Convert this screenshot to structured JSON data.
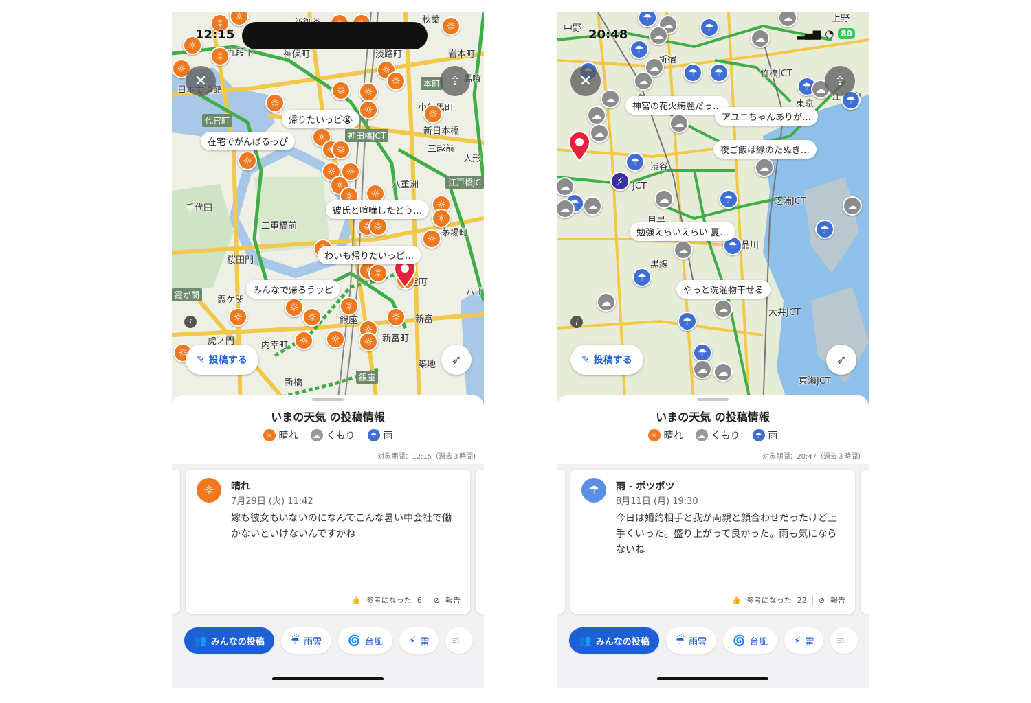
{
  "left": {
    "status_time": "12:15",
    "places": [
      {
        "text": "新御茶",
        "cls": "place"
      },
      {
        "text": "秋葉",
        "cls": "place"
      },
      {
        "text": "九段下",
        "cls": "place"
      },
      {
        "text": "神保町",
        "cls": "place"
      },
      {
        "text": "淡路町",
        "cls": "place"
      },
      {
        "text": "岩本町",
        "cls": "place"
      },
      {
        "text": "日本武道館",
        "cls": "place"
      },
      {
        "text": "本町",
        "cls": "road-label"
      },
      {
        "text": "馬喰",
        "cls": "place"
      },
      {
        "text": "小伝馬町",
        "cls": "place"
      },
      {
        "text": "代官町",
        "cls": "road-label"
      },
      {
        "text": "神田橋JCT",
        "cls": "road-label"
      },
      {
        "text": "新日本橋",
        "cls": "place"
      },
      {
        "text": "三越前",
        "cls": "place"
      },
      {
        "text": "人形",
        "cls": "place"
      },
      {
        "text": "千代田",
        "cls": "place"
      },
      {
        "text": "八重洲",
        "cls": "place"
      },
      {
        "text": "江戸橋JC",
        "cls": "road-label"
      },
      {
        "text": "二重橋前",
        "cls": "place"
      },
      {
        "text": "茅場町",
        "cls": "place"
      },
      {
        "text": "桜田門",
        "cls": "place"
      },
      {
        "text": "宝町",
        "cls": "place"
      },
      {
        "text": "八丁",
        "cls": "place"
      },
      {
        "text": "霞が関",
        "cls": "road-label"
      },
      {
        "text": "霞ケ関",
        "cls": "place"
      },
      {
        "text": "銀座",
        "cls": "place"
      },
      {
        "text": "新富",
        "cls": "place"
      },
      {
        "text": "虎ノ門",
        "cls": "place"
      },
      {
        "text": "内幸町",
        "cls": "place"
      },
      {
        "text": "新富町",
        "cls": "place"
      },
      {
        "text": "築地",
        "cls": "place"
      },
      {
        "text": "新橋",
        "cls": "place"
      },
      {
        "text": "銀座",
        "cls": "road-label"
      }
    ],
    "bubbles": [
      "帰りたいっピ😭",
      "在宅でがんばるっぴ",
      "彼氏と喧嘩したどう…",
      "わいも帰りたいっピ…",
      "みんなで帰ろうッピ"
    ],
    "card": {
      "weather": "晴れ",
      "date": "7月29日 (火) 11:42",
      "body": "嫁も彼女もいないのになんでこんな暑い中会社で働かないといけないんですかね",
      "helpful_label": "参考になった",
      "helpful_count": "6",
      "report_label": "報告"
    },
    "period": "対象期間：12:15（過去３時間)"
  },
  "right": {
    "status_time": "20:48",
    "battery": "80",
    "places": [
      {
        "text": "中野",
        "cls": "place"
      },
      {
        "text": "上野",
        "cls": "place"
      },
      {
        "text": "新宿",
        "cls": "place"
      },
      {
        "text": "竹橋JCT",
        "cls": "place"
      },
      {
        "text": "東京",
        "cls": "place"
      },
      {
        "text": "江戸橋J",
        "cls": "place"
      },
      {
        "text": "渋谷",
        "cls": "place"
      },
      {
        "text": "JCT",
        "cls": "place"
      },
      {
        "text": "芝浦JCT",
        "cls": "place"
      },
      {
        "text": "目黒",
        "cls": "place"
      },
      {
        "text": "品川",
        "cls": "place"
      },
      {
        "text": "黒線",
        "cls": "place"
      },
      {
        "text": "大井JCT",
        "cls": "place"
      },
      {
        "text": "東海JCT",
        "cls": "place"
      }
    ],
    "bubbles": [
      "神宮の花火綺麗だっ…",
      "アユニちゃんありが…",
      "夜ご飯は緑のたぬき…",
      "勉強えらいえらい 夏…",
      "やっと洗濯物干せる"
    ],
    "card": {
      "weather": "雨 - ポツポツ",
      "date": "8月11日 (月) 19:30",
      "body": "今日は婚約相手と我が両親と顔合わせだったけど上手くいった。盛り上がって良かった。雨も気にならないね",
      "helpful_label": "参考になった",
      "helpful_count": "22",
      "report_label": "報告"
    },
    "period": "対象期間：20:47（過去３時間)"
  },
  "common": {
    "post_button": "投稿する",
    "sheet_title": "いまの天気 の投稿情報",
    "legend": [
      {
        "label": "晴れ",
        "kind": "sunny"
      },
      {
        "label": "くもり",
        "kind": "cloudy"
      },
      {
        "label": "雨",
        "kind": "rain"
      }
    ],
    "chips": [
      {
        "label": "みんなの投稿",
        "icon": "people-icon"
      },
      {
        "label": "雨雲",
        "icon": "rain-cloud-icon"
      },
      {
        "label": "台風",
        "icon": "typhoon-icon"
      },
      {
        "label": "雷",
        "icon": "lightning-icon"
      }
    ],
    "colors": {
      "accent": "#1d5fd6",
      "sunny": "#f0781e",
      "cloudy": "#8c8c8c",
      "rain": "#3f6fd6",
      "pin": "#e8223a"
    }
  }
}
